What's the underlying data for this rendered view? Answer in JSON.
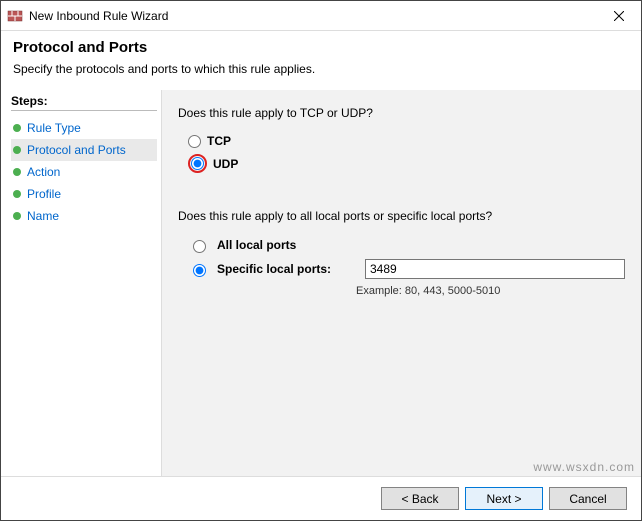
{
  "window": {
    "title": "New Inbound Rule Wizard"
  },
  "header": {
    "title": "Protocol and Ports",
    "subtitle": "Specify the protocols and ports to which this rule applies."
  },
  "sidebar": {
    "heading": "Steps:",
    "items": [
      {
        "label": "Rule Type",
        "current": false
      },
      {
        "label": "Protocol and Ports",
        "current": true
      },
      {
        "label": "Action",
        "current": false
      },
      {
        "label": "Profile",
        "current": false
      },
      {
        "label": "Name",
        "current": false
      }
    ]
  },
  "content": {
    "q_protocol": "Does this rule apply to TCP or UDP?",
    "opt_tcp": "TCP",
    "opt_udp": "UDP",
    "protocol_selected": "UDP",
    "q_ports": "Does this rule apply to all local ports or specific local ports?",
    "opt_all_ports": "All local ports",
    "opt_specific_ports": "Specific local ports:",
    "ports_selected": "specific",
    "ports_value": "3489",
    "ports_example": "Example: 80, 443, 5000-5010"
  },
  "footer": {
    "back": "< Back",
    "next": "Next >",
    "cancel": "Cancel"
  },
  "watermark": "www.wsxdn.com"
}
